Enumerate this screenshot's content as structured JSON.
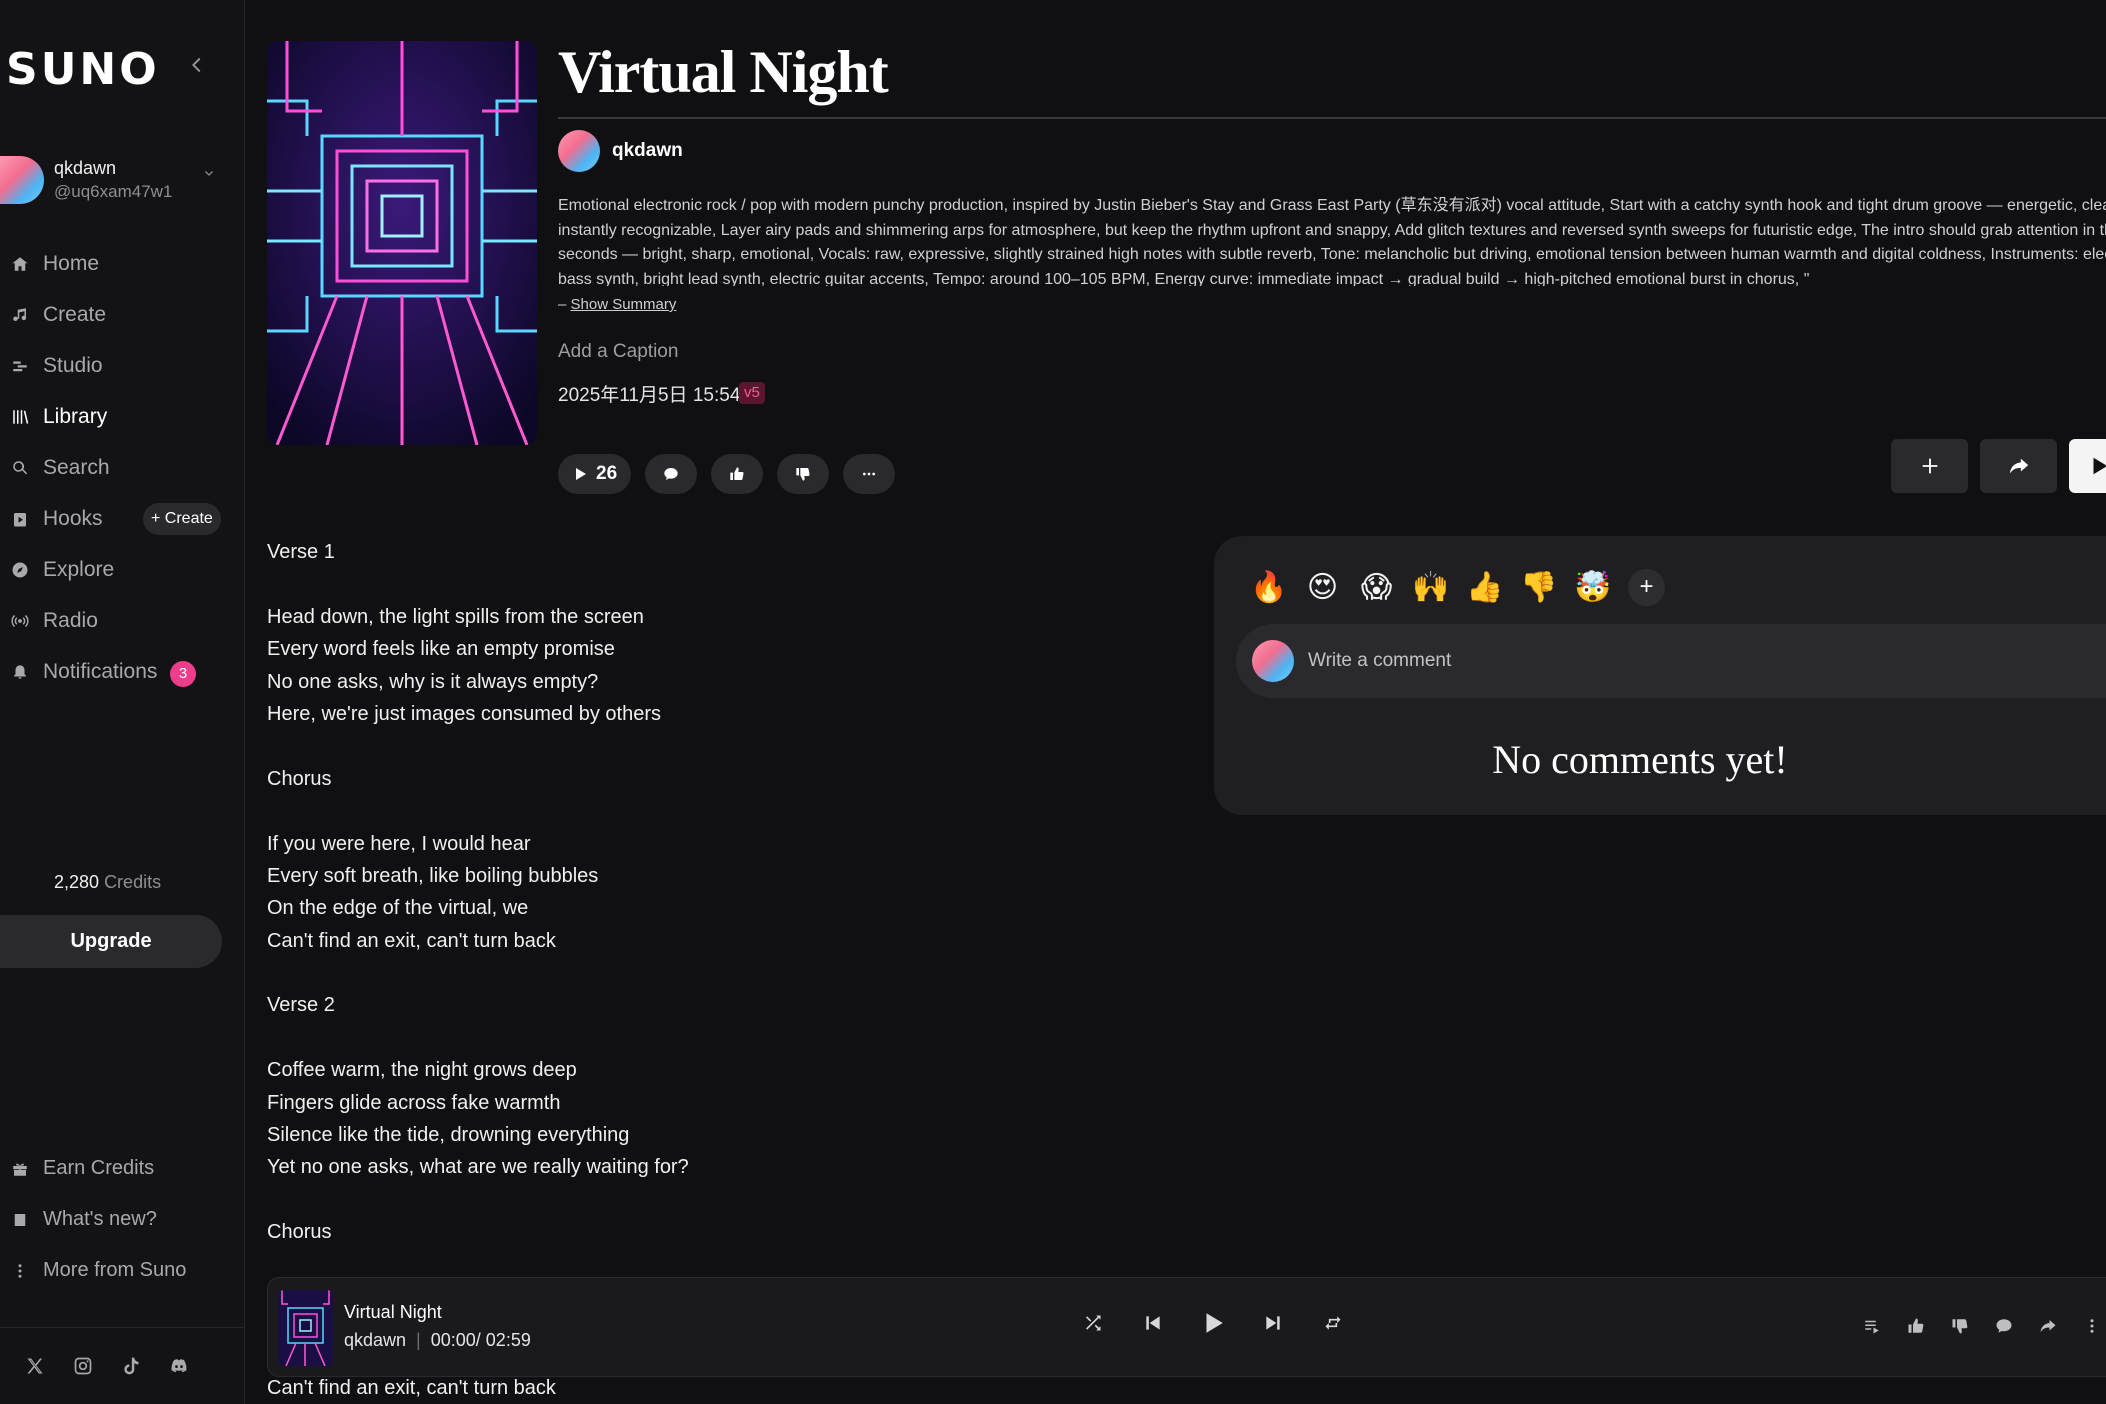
{
  "sidebar": {
    "logo": "SUNO",
    "user": {
      "name": "qkdawn",
      "handle": "@uq6xam47w1"
    },
    "nav": [
      {
        "label": "Home",
        "icon": "home-icon"
      },
      {
        "label": "Create",
        "icon": "music-note-icon"
      },
      {
        "label": "Studio",
        "icon": "studio-icon"
      },
      {
        "label": "Library",
        "icon": "library-icon",
        "active": true
      },
      {
        "label": "Search",
        "icon": "search-icon"
      },
      {
        "label": "Hooks",
        "icon": "hooks-icon"
      },
      {
        "label": "Explore",
        "icon": "explore-icon"
      },
      {
        "label": "Radio",
        "icon": "radio-icon"
      },
      {
        "label": "Notifications",
        "icon": "bell-icon"
      }
    ],
    "hooks_create_label": "+ Create",
    "notifications_count": "3",
    "credits_value": "2,280",
    "credits_label": "Credits",
    "upgrade_label": "Upgrade",
    "footer": [
      {
        "label": "Earn Credits",
        "icon": "gift-icon"
      },
      {
        "label": "What's new?",
        "icon": "news-icon"
      },
      {
        "label": "More from Suno",
        "icon": "more-vertical-icon"
      }
    ],
    "socials": [
      "x-icon",
      "instagram-icon",
      "tiktok-icon",
      "discord-icon"
    ]
  },
  "song": {
    "title": "Virtual Night",
    "artist": "qkdawn",
    "description_lines": [
      "Emotional electronic rock / pop with modern punchy production, inspired by Justin Bieber's Stay and Grass East Party (草东没有派对) vocal attitude, Start with a catchy synth hook and tight drum groove — energetic, clean, and",
      "instantly recognizable, Layer airy pads and shimmering arps for atmosphere, but keep the rhythm upfront and snappy, Add glitch textures and reversed synth sweeps for futuristic edge, The intro should grab attention in the first fe",
      "seconds — bright, sharp, emotional, Vocals: raw, expressive, slightly strained high notes with subtle reverb, Tone: melancholic but driving, emotional tension between human warmth and digital coldness, Instruments: electronic dru",
      "bass synth, bright lead synth, electric guitar accents, Tempo: around 100–105 BPM, Energy curve: immediate impact → gradual build → high-pitched emotional burst in chorus, \""
    ],
    "show_summary_prefix": "– ",
    "show_summary_label": "Show Summary",
    "caption_placeholder": "Add a Caption",
    "date": "2025年11月5日 15:54",
    "version": "v5",
    "play_count": "26"
  },
  "lyrics": [
    "Verse 1",
    "",
    "Head down, the light spills from the screen",
    "Every word feels like an empty promise",
    "No one asks, why is it always empty?",
    "Here, we're just images consumed by others",
    "",
    "Chorus",
    "",
    "If you were here, I would hear",
    "Every soft breath, like boiling bubbles",
    "On the edge of the virtual, we",
    "Can't find an exit, can't turn back",
    "",
    "Verse 2",
    "",
    "Coffee warm, the night grows deep",
    "Fingers glide across fake warmth",
    "Silence like the tide, drowning everything",
    "Yet no one asks, what are we really waiting for?",
    "",
    "Chorus"
  ],
  "lyric_tail": "Can't find an exit, can't turn back",
  "comments": {
    "emojis": [
      "🔥",
      "😍",
      "😱",
      "🙌",
      "👍",
      "👎",
      "🤯"
    ],
    "placeholder": "Write a comment",
    "empty_text": "No comments yet!"
  },
  "player": {
    "title": "Virtual Night",
    "artist": "qkdawn",
    "current_time": "00:00",
    "duration": "02:59"
  },
  "colors": {
    "background": "#101012",
    "accent_pink": "#ee3d8a",
    "version_badge": "#ff5a96"
  }
}
